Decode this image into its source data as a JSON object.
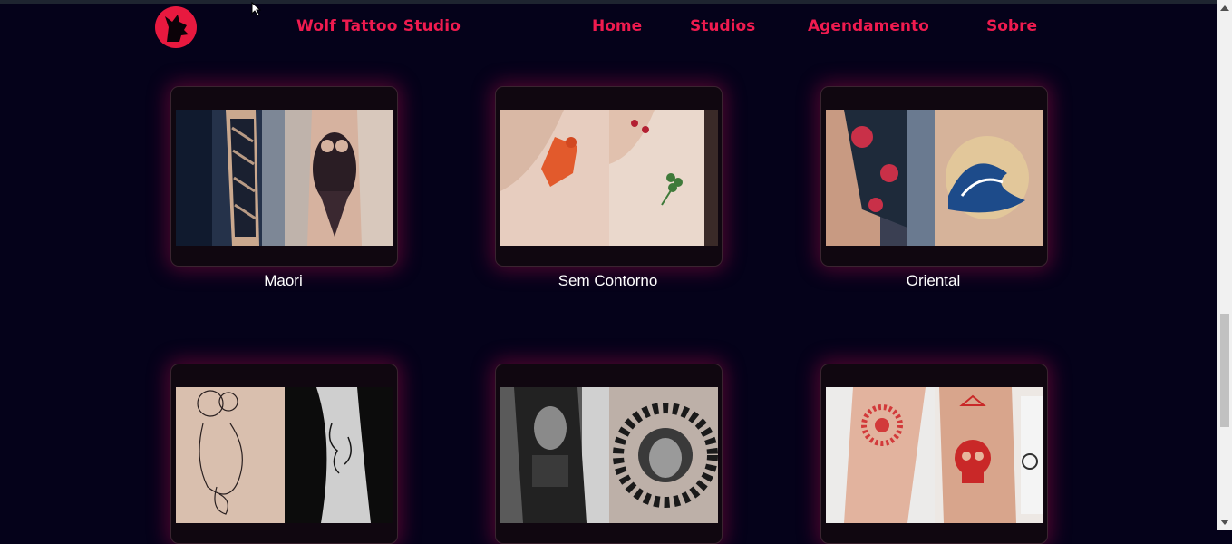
{
  "header": {
    "logo_icon": "wolf-head-icon",
    "brand": "Wolf Tattoo Studio",
    "nav": [
      "Home",
      "Studios",
      "Agendamento",
      "Sobre"
    ],
    "accent_color": "#ef1b4f"
  },
  "gallery": [
    {
      "caption": "Maori",
      "image": "maori-tattoo-photos"
    },
    {
      "caption": "Sem Contorno",
      "image": "no-outline-tattoo-photos"
    },
    {
      "caption": "Oriental",
      "image": "oriental-tattoo-photos"
    },
    {
      "caption": "",
      "image": "fine-line-tattoo-photos"
    },
    {
      "caption": "",
      "image": "realism-tattoo-photos"
    },
    {
      "caption": "",
      "image": "red-ink-tattoo-photos"
    }
  ]
}
